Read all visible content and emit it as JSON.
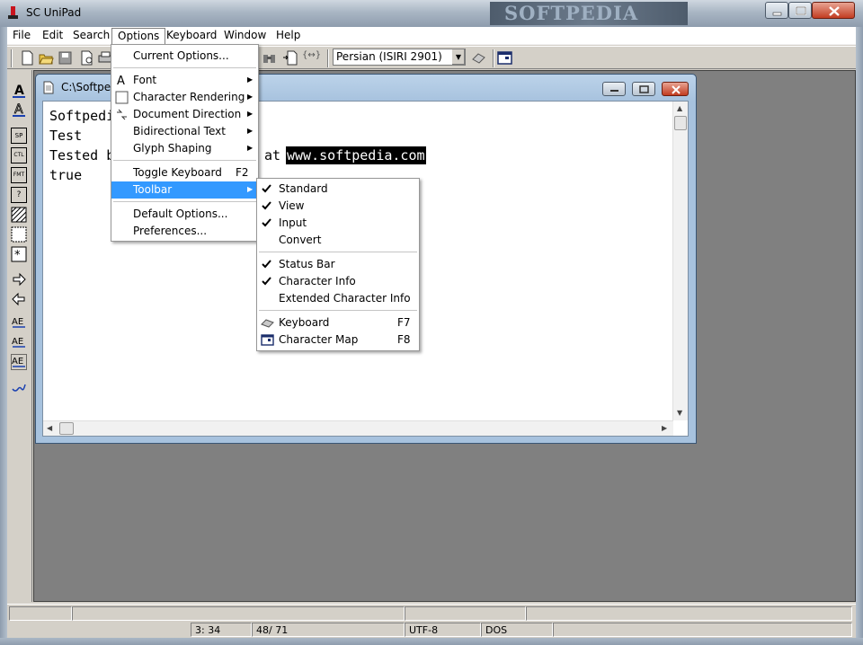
{
  "window": {
    "title": "SC UniPad",
    "watermark": "SOFTPEDIA"
  },
  "menubar": [
    "File",
    "Edit",
    "Search",
    "Options",
    "Keyboard",
    "Window",
    "Help"
  ],
  "toolbar": {
    "keyboard_layout": "Persian (ISIRI 2901)"
  },
  "document": {
    "title": "C:\\Softpec",
    "lines": [
      "Softpedi",
      "Test",
      "Tested b",
      "true"
    ],
    "line3_tail": "at ",
    "selected_text": "www.softpedia.com"
  },
  "options_menu": {
    "items": [
      {
        "label": "Current Options...",
        "icon": "",
        "shortcut": "",
        "submenu": false
      },
      {
        "label": "Font",
        "icon": "font-icon",
        "shortcut": "",
        "submenu": true
      },
      {
        "label": "Character Rendering",
        "icon": "rendering-box-icon",
        "shortcut": "",
        "submenu": true
      },
      {
        "label": "Document Direction",
        "icon": "direction-icon",
        "shortcut": "",
        "submenu": true
      },
      {
        "label": "Bidirectional Text",
        "icon": "",
        "shortcut": "",
        "submenu": true
      },
      {
        "label": "Glyph Shaping",
        "icon": "",
        "shortcut": "",
        "submenu": true
      },
      {
        "label": "Toggle Keyboard",
        "icon": "",
        "shortcut": "F2",
        "submenu": false
      },
      {
        "label": "Toolbar",
        "icon": "",
        "shortcut": "",
        "submenu": true,
        "highlighted": true
      },
      {
        "label": "Default Options...",
        "icon": "",
        "shortcut": "",
        "submenu": false
      },
      {
        "label": "Preferences...",
        "icon": "",
        "shortcut": "",
        "submenu": false
      }
    ]
  },
  "toolbar_submenu": {
    "items": [
      {
        "label": "Standard",
        "checked": true,
        "shortcut": ""
      },
      {
        "label": "View",
        "checked": true,
        "shortcut": ""
      },
      {
        "label": "Input",
        "checked": true,
        "shortcut": ""
      },
      {
        "label": "Convert",
        "checked": false,
        "shortcut": ""
      },
      {
        "label": "Status Bar",
        "checked": true,
        "shortcut": ""
      },
      {
        "label": "Character Info",
        "checked": true,
        "shortcut": ""
      },
      {
        "label": "Extended Character Info",
        "checked": false,
        "shortcut": ""
      },
      {
        "label": "Keyboard",
        "checked": false,
        "shortcut": "F7",
        "icon": "keyboard-icon"
      },
      {
        "label": "Character Map",
        "checked": false,
        "shortcut": "F8",
        "icon": "character-map-icon"
      }
    ]
  },
  "statusbar": {
    "position": "3: 34",
    "count": "48/ 71",
    "encoding": "UTF-8",
    "line_ending": "DOS"
  },
  "vtoolbar_labels": [
    "SP",
    "CTL",
    "FMT",
    "?"
  ],
  "colors": {
    "menu_highlight": "#3399ff",
    "selection_bg": "#000000",
    "mdi_background": "#808080"
  }
}
